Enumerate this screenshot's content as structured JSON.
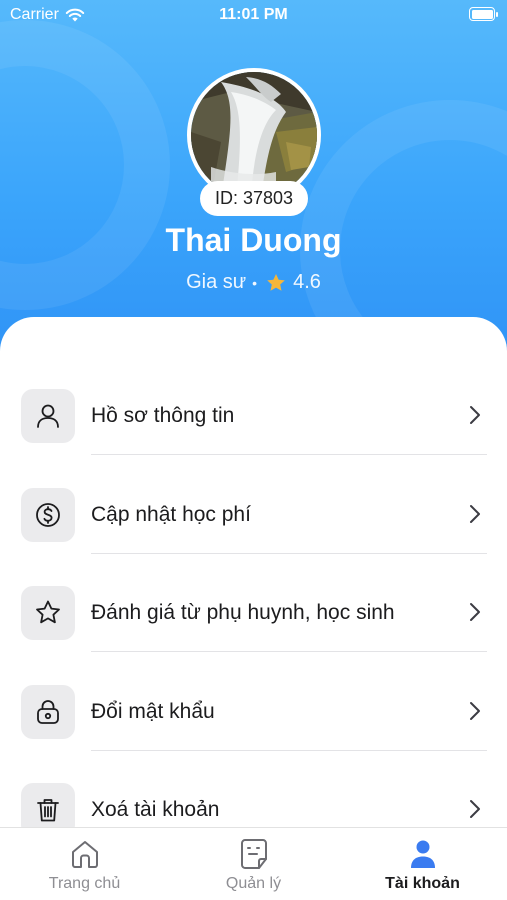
{
  "status_bar": {
    "carrier": "Carrier",
    "time": "11:01 PM"
  },
  "profile": {
    "id_label": "ID: 37803",
    "name": "Thai Duong",
    "role": "Gia sư",
    "separator": "•",
    "rating": "4.6"
  },
  "menu": {
    "items": [
      {
        "label": "Hồ sơ thông tin",
        "icon": "user-icon"
      },
      {
        "label": "Cập nhật học phí",
        "icon": "dollar-icon"
      },
      {
        "label": "Đánh giá từ phụ huynh, học sinh",
        "icon": "star-icon"
      },
      {
        "label": "Đổi mật khẩu",
        "icon": "lock-icon"
      },
      {
        "label": "Xoá tài khoản",
        "icon": "trash-icon"
      }
    ]
  },
  "tabbar": {
    "tabs": [
      {
        "label": "Trang chủ",
        "icon": "home-icon",
        "active": false
      },
      {
        "label": "Quản lý",
        "icon": "document-icon",
        "active": false
      },
      {
        "label": "Tài khoản",
        "icon": "person-icon",
        "active": true
      }
    ]
  },
  "colors": {
    "header_gradient_top": "#56b9fb",
    "header_gradient_bottom": "#2f93f6",
    "active_tab_icon": "#3a7bf0",
    "rating_star": "#f5b63a"
  }
}
